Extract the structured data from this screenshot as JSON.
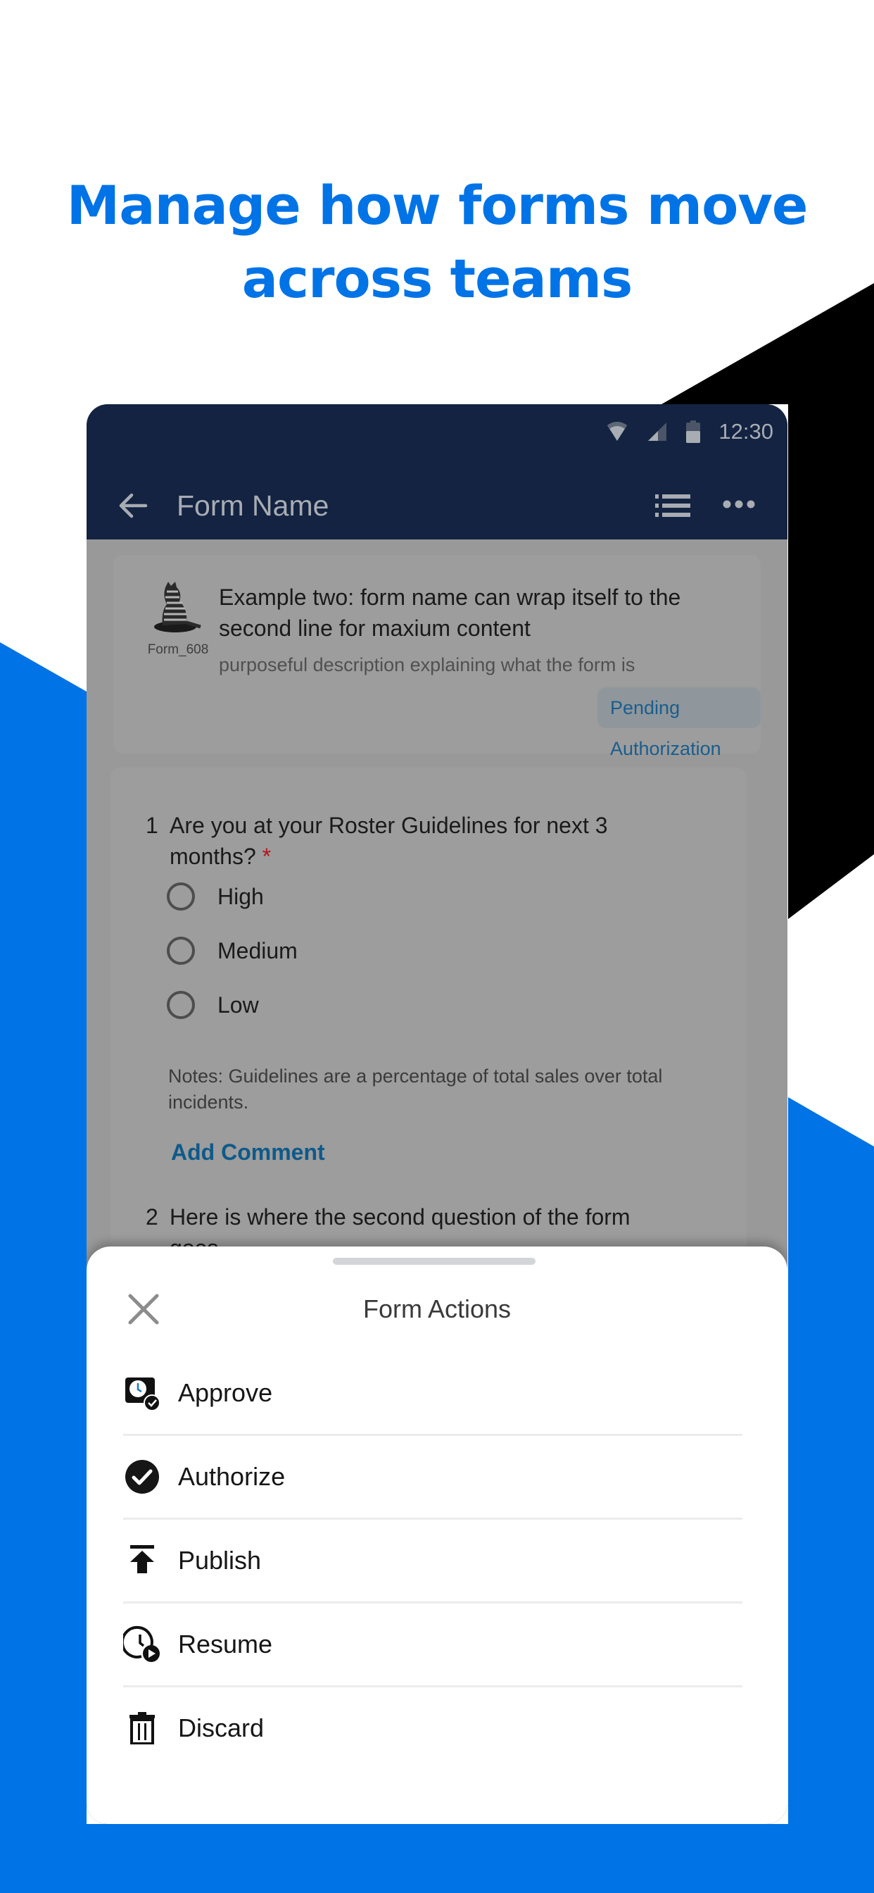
{
  "headline": {
    "line1": "Manage how forms move",
    "line2": "across teams"
  },
  "colors": {
    "brand_blue": "#0073e6",
    "app_bar": "#132341",
    "status_badge_text": "#1b5d8c",
    "required_star": "#b3141c"
  },
  "status_bar": {
    "time": "12:30",
    "icons": [
      "wifi-icon",
      "signal-icon",
      "battery-icon"
    ]
  },
  "app_bar": {
    "title": "Form Name",
    "back_icon": "arrow-left-icon",
    "list_icon": "list-icon",
    "more_icon": "more-horizontal-icon"
  },
  "form_card": {
    "form_id": "Form_608",
    "title": "Example two: form name can wrap itself to the second line for maxium content",
    "description": "purposeful description explaining what the form is",
    "status": "Pending Authorization"
  },
  "questions": [
    {
      "number": "1",
      "text": "Are you at your Roster Guidelines for next 3 months?",
      "required_marker": "*",
      "options": [
        "High",
        "Medium",
        "Low"
      ],
      "notes": "Notes: Guidelines are a percentage of total sales over total incidents.",
      "add_comment_label": "Add Comment"
    },
    {
      "number": "2",
      "text": "Here is where the second question of the form goes"
    }
  ],
  "sheet": {
    "title": "Form Actions",
    "close_icon": "close-icon",
    "actions": [
      {
        "label": "Approve",
        "icon": "approve-clock-check-icon"
      },
      {
        "label": "Authorize",
        "icon": "check-circle-icon"
      },
      {
        "label": "Publish",
        "icon": "publish-arrow-up-icon"
      },
      {
        "label": "Resume",
        "icon": "clock-play-icon"
      },
      {
        "label": "Discard",
        "icon": "trash-icon"
      }
    ]
  }
}
